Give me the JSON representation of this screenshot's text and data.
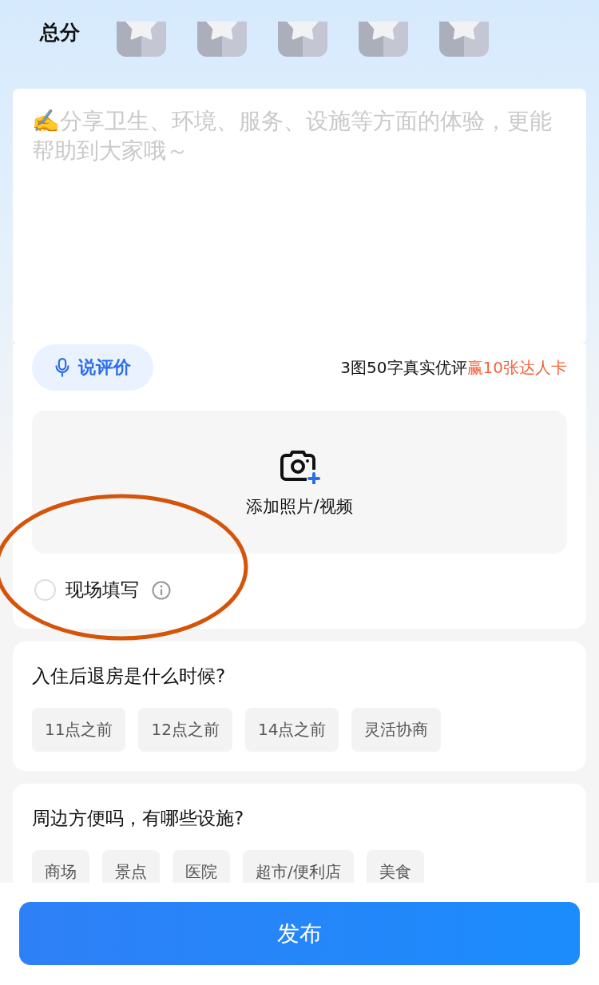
{
  "rating": {
    "label": "总分",
    "stars": 0
  },
  "review": {
    "placeholder": "✍️分享卫生、环境、服务、设施等方面的体验，更能帮助到大家哦～",
    "voice_button": "说评价",
    "promo_text": "3图50字真实优评",
    "promo_highlight": "赢10张达人卡",
    "upload_label": "添加照片/视频",
    "onsite": {
      "label": "现场填写",
      "checked": false
    }
  },
  "questions": [
    {
      "title": "入住后退房是什么时候?",
      "options": [
        {
          "label": "11点之前",
          "selected": false
        },
        {
          "label": "12点之前",
          "selected": false
        },
        {
          "label": "14点之前",
          "selected": false
        },
        {
          "label": "灵活协商",
          "selected": false
        }
      ]
    },
    {
      "title": "周边方便吗，有哪些设施?",
      "options": [
        {
          "label": "商场",
          "selected": false
        },
        {
          "label": "景点",
          "selected": false
        },
        {
          "label": "医院",
          "selected": false
        },
        {
          "label": "超市/便利店",
          "selected": false
        },
        {
          "label": "美食",
          "selected": false
        }
      ]
    }
  ],
  "submit_button": "发布"
}
